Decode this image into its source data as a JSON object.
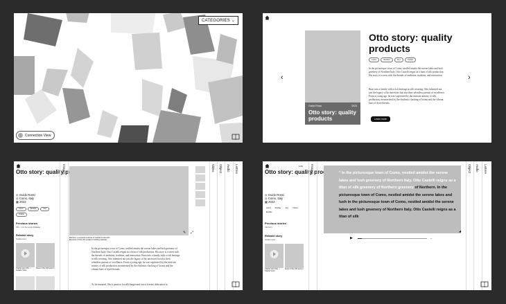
{
  "panel1": {
    "categories_label": "CATEGORIES",
    "connection_label": "Connection View"
  },
  "panel2": {
    "cover_author": "Guido Rossi",
    "cover_year": "2023",
    "cover_title": "Otto story: quality products",
    "title": "Otto story: quality products",
    "tags": [
      "Loisirs",
      "Meubles",
      "Jeux",
      "Cuisine"
    ],
    "para1": "In the picturesque town of Como, nestled amidst the serene lakes and lush greenery of Northern Italy, Otto Castelli reigns as a titan of silk production. His story is woven with the threads of ambition, tradition, and innovation.",
    "para2": "Born into a family with a rich heritage in silk weaving, Otto inherited not just the legacy of his ancestors but also their relentless pursuit of excellence. From a young age, he was captivated by the intricate artistry of silk production, mesmerized by the rhythmic clacking of looms and the vibrant hues of dyed threads.",
    "learn_more": "Learn more"
  },
  "panel3": {
    "title": "Otto story: quality products",
    "author": "Guido Rossi",
    "location": "Como, Italy",
    "year": "2023",
    "tags": [
      "Loisirs",
      "Meubles",
      "Jeux",
      "Cuisine"
    ],
    "previous_heading": "Previous stories",
    "previous_sub": "Otto — For the record of Baltasar",
    "related_heading": "Related story",
    "related_sub": "Suitable items",
    "card1_caption": "Cladrar story Otto — Suitable Victor",
    "card2_caption": "Seven of the 100 women",
    "caption_text": "Elia Ricci: a wonderful example of material to build with. Elements of Otto's life recalled in building materials.",
    "body1": "In the picturesque town of Como, nestled amidst the serene lakes and lush greenery of Northern Italy, Otto Castelli reigns as a titan of silk production. His story is woven with the threads of ambition, tradition, and innovation. Born into a family with a rich heritage in silk weaving, Otto inherited not just the legacy of his ancestors but also their relentless pursuit of excellence. From a young age, he was captivated by the intricate artistry of silk production, mesmerized by the rhythmic clacking of looms and the vibrant hues of dyed threads.",
    "body2": "As he matured, Otto's passion for silk burgeoned into a fervent dedication to",
    "vtabs": [
      "Images",
      "Video",
      "Object",
      "Audio",
      "Lettere"
    ]
  },
  "panel4": {
    "title": "Otto story: quality products",
    "author": "Guido Rossi",
    "location": "Como, Italy",
    "year": "2023",
    "page_counter": "1/20",
    "tags": [
      "Loisirs",
      "Meubles",
      "Jeux",
      "Cuisine",
      "Ecarlate"
    ],
    "previous_heading": "Previous stories",
    "previous_sub": "Otto Story",
    "related_heading": "Related story",
    "related_sub": "Suitable items",
    "card1_caption": "Cladrar story Otto — Cladrar Victor",
    "card2_caption": "Seven of the 100 women",
    "quote_light": "\" In the picturesque town of Como, nestled amidst the serene lakes and lush greenery of Northern Italy, Otto Castelli reigns as a titan of silk greenery of Northern greenery",
    "quote_dark": "of Northern. In the picturesque town of Como, nestled amidst the serene lakes and lush in the picturesque town of Como, nestled amidst the serene lakes and lush greenery of Northern Italy, Otto Castelli reigns as a titan of silk",
    "vtabs": [
      "Images",
      "Object",
      "Audio",
      "Lettere"
    ]
  }
}
